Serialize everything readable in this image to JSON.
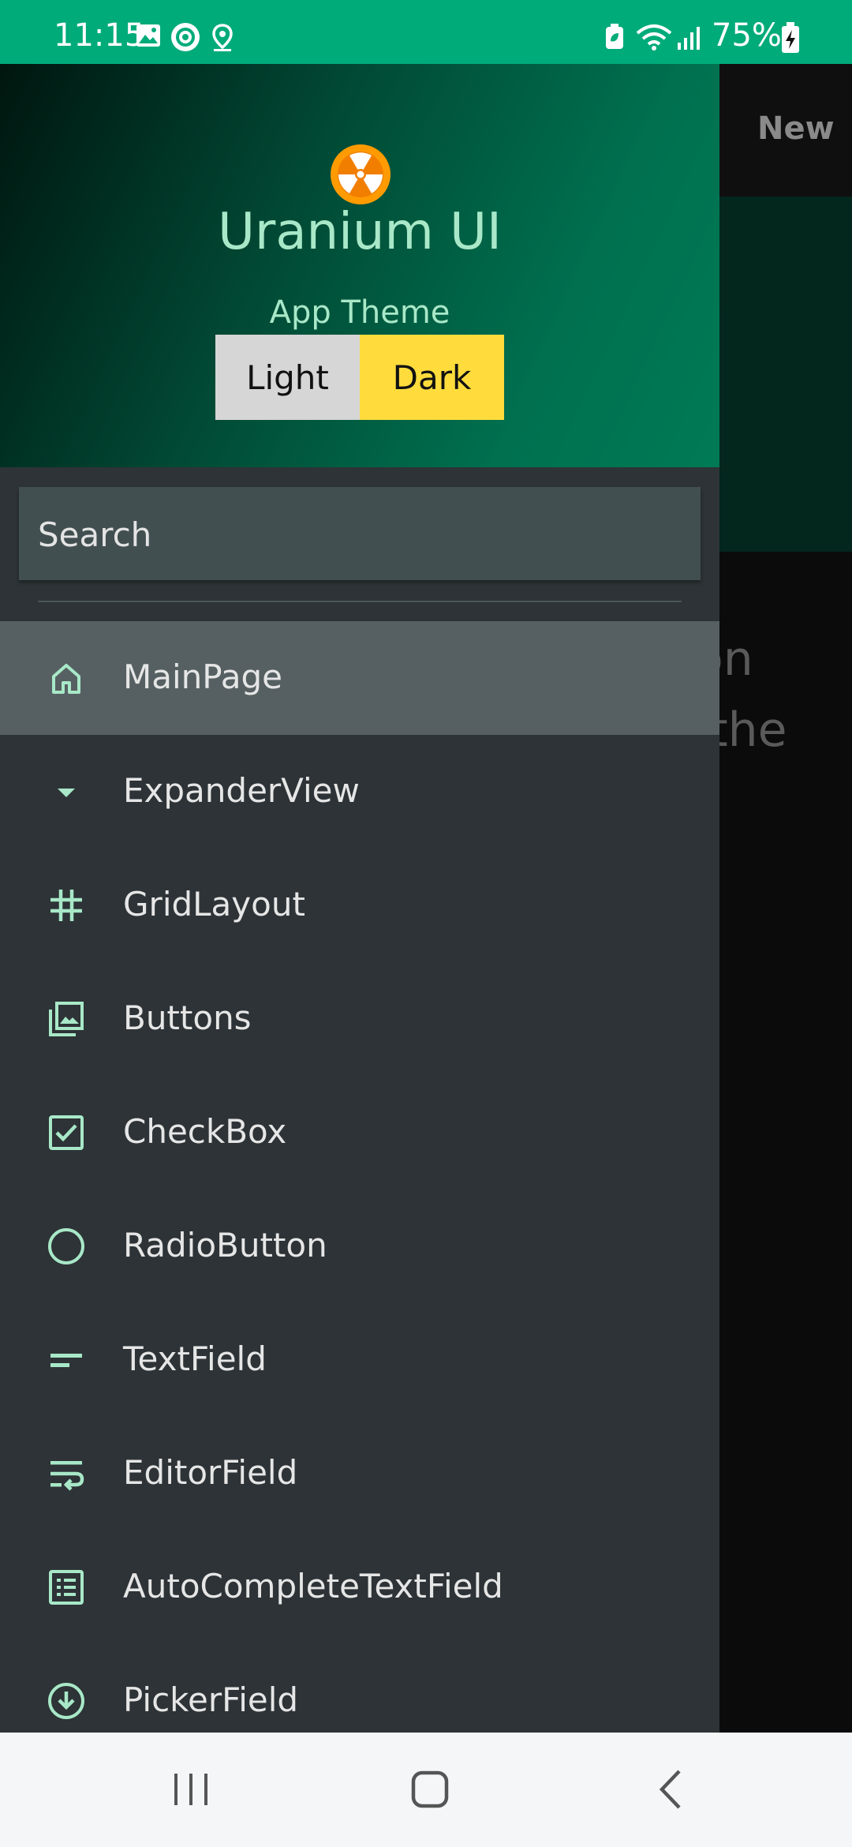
{
  "status_bar": {
    "time": "11:15",
    "battery_percent": "75%",
    "left_icons": [
      "image-icon",
      "sync-icon",
      "location-icon"
    ],
    "right_icons": [
      "battery-saver-icon",
      "wifi-icon",
      "signal-icon",
      "battery-charging-icon"
    ]
  },
  "background_app": {
    "toolbar_action": "New",
    "text_fragment": "on\n the"
  },
  "drawer": {
    "logo_icon": "radiation-icon",
    "app_title": "Uranium UI",
    "theme_label": "App Theme",
    "theme_options": [
      "Light",
      "Dark"
    ],
    "theme_selected": "Dark",
    "search_placeholder": "Search",
    "items": [
      {
        "label": "MainPage",
        "icon": "home-icon",
        "selected": true
      },
      {
        "label": "ExpanderView",
        "icon": "arrow-drop-down-icon",
        "selected": false
      },
      {
        "label": "GridLayout",
        "icon": "grid-hash-icon",
        "selected": false
      },
      {
        "label": "Buttons",
        "icon": "photo-library-icon",
        "selected": false
      },
      {
        "label": "CheckBox",
        "icon": "checkbox-icon",
        "selected": false
      },
      {
        "label": "RadioButton",
        "icon": "radio-circle-icon",
        "selected": false
      },
      {
        "label": "TextField",
        "icon": "short-text-icon",
        "selected": false
      },
      {
        "label": "EditorField",
        "icon": "wrap-text-icon",
        "selected": false
      },
      {
        "label": "AutoCompleteTextField",
        "icon": "list-alt-icon",
        "selected": false
      },
      {
        "label": "PickerField",
        "icon": "arrow-circle-down-icon",
        "selected": false
      }
    ]
  },
  "nav_bar": {
    "buttons": [
      "recents-button",
      "home-button",
      "back-button"
    ]
  },
  "colors": {
    "status_bar": "#00ab7a",
    "accent_icon": "#a8e8c8",
    "theme_dark_active": "#ffdc3c",
    "theme_light": "#d6d6d6",
    "drawer_bg": "#2d3336",
    "selected_item_bg": "#566062"
  }
}
